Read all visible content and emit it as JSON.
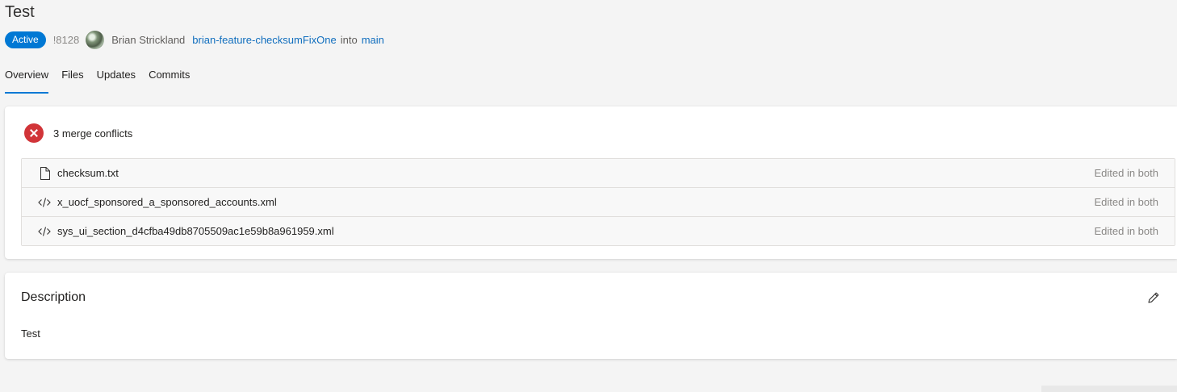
{
  "pr": {
    "title": "Test",
    "status": "Active",
    "id": "!8128",
    "author": "Brian Strickland",
    "source_branch": "brian-feature-checksumFixOne",
    "into_text": "into",
    "target_branch": "main"
  },
  "tabs": [
    {
      "label": "Overview",
      "active": true
    },
    {
      "label": "Files",
      "active": false
    },
    {
      "label": "Updates",
      "active": false
    },
    {
      "label": "Commits",
      "active": false
    }
  ],
  "conflicts": {
    "summary": "3 merge conflicts",
    "icon": "error-circle-icon",
    "files": [
      {
        "name": "checksum.txt",
        "status": "Edited in both",
        "icon": "file-icon"
      },
      {
        "name": "x_uocf_sponsored_a_sponsored_accounts.xml",
        "status": "Edited in both",
        "icon": "code-icon"
      },
      {
        "name": "sys_ui_section_d4cfba49db8705509ac1e59b8a961959.xml",
        "status": "Edited in both",
        "icon": "code-icon"
      }
    ]
  },
  "description": {
    "heading": "Description",
    "text": "Test",
    "edit_icon": "pencil-icon"
  },
  "colors": {
    "accent": "#0078d4",
    "link": "#106ebe",
    "error": "#d13438",
    "background": "#f4f4f4"
  }
}
